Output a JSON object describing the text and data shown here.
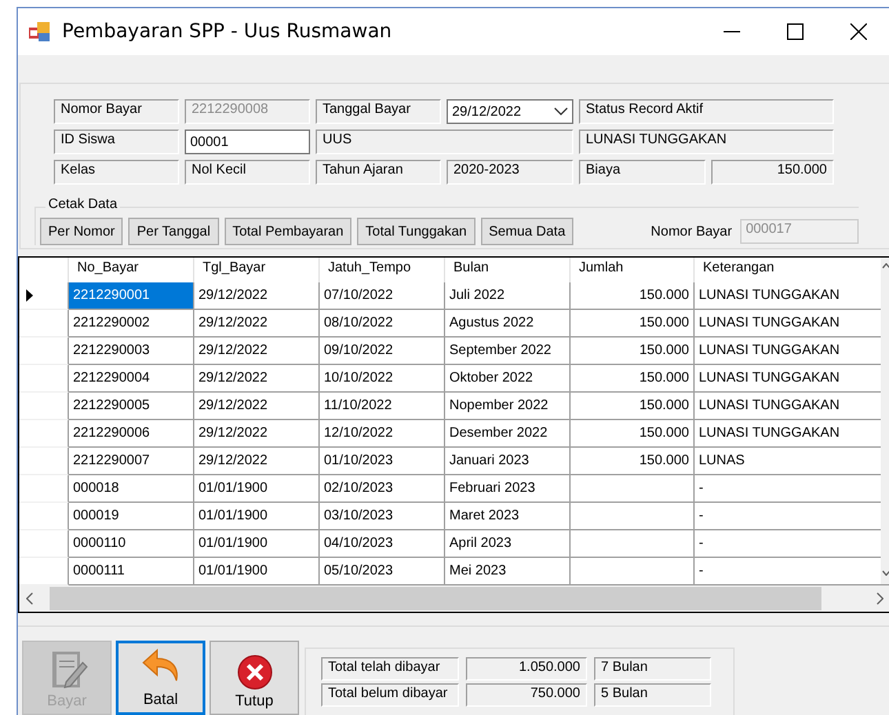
{
  "window": {
    "title": "Pembayaran SPP - Uus Rusmawan"
  },
  "form": {
    "nomor_bayar": {
      "label": "Nomor Bayar",
      "value": "2212290008",
      "disabled": true
    },
    "tanggal_bayar": {
      "label": "Tanggal Bayar",
      "value": "29/12/2022"
    },
    "status_record": "Status Record Aktif",
    "id_siswa": {
      "label": "ID Siswa",
      "value": "00001"
    },
    "nama": "UUS",
    "keterangan": "LUNASI TUNGGAKAN",
    "kelas": {
      "label": "Kelas",
      "value": "Nol Kecil"
    },
    "tahun_ajaran": {
      "label": "Tahun Ajaran",
      "value": "2020-2023"
    },
    "biaya": {
      "label": "Biaya",
      "value": "150.000"
    }
  },
  "cetak_data": {
    "title": "Cetak Data",
    "buttons": [
      "Per Nomor",
      "Per Tanggal",
      "Total Pembayaran",
      "Total Tunggakan",
      "Semua Data"
    ],
    "nomor_bayar": {
      "label": "Nomor Bayar",
      "value": "000017",
      "disabled": true
    }
  },
  "table": {
    "columns": [
      "No_Bayar",
      "Tgl_Bayar",
      "Jatuh_Tempo",
      "Bulan",
      "Jumlah",
      "Keterangan"
    ],
    "rows": [
      {
        "cells": [
          "2212290001",
          "29/12/2022",
          "07/10/2022",
          "Juli 2022",
          "150.000",
          "LUNASI TUNGGAKAN"
        ],
        "selected": true
      },
      {
        "cells": [
          "2212290002",
          "29/12/2022",
          "08/10/2022",
          "Agustus 2022",
          "150.000",
          "LUNASI TUNGGAKAN"
        ],
        "selected": false
      },
      {
        "cells": [
          "2212290003",
          "29/12/2022",
          "09/10/2022",
          "September 2022",
          "150.000",
          "LUNASI TUNGGAKAN"
        ],
        "selected": false
      },
      {
        "cells": [
          "2212290004",
          "29/12/2022",
          "10/10/2022",
          "Oktober 2022",
          "150.000",
          "LUNASI TUNGGAKAN"
        ],
        "selected": false
      },
      {
        "cells": [
          "2212290005",
          "29/12/2022",
          "11/10/2022",
          "Nopember 2022",
          "150.000",
          "LUNASI TUNGGAKAN"
        ],
        "selected": false
      },
      {
        "cells": [
          "2212290006",
          "29/12/2022",
          "12/10/2022",
          "Desember 2022",
          "150.000",
          "LUNASI TUNGGAKAN"
        ],
        "selected": false
      },
      {
        "cells": [
          "2212290007",
          "29/12/2022",
          "01/10/2023",
          "Januari 2023",
          "150.000",
          "LUNAS"
        ],
        "selected": false
      },
      {
        "cells": [
          "000018",
          "01/01/1900",
          "02/10/2023",
          "Februari 2023",
          "",
          "-"
        ],
        "selected": false
      },
      {
        "cells": [
          "000019",
          "01/01/1900",
          "03/10/2023",
          "Maret 2023",
          "",
          "-"
        ],
        "selected": false
      },
      {
        "cells": [
          "0000110",
          "01/01/1900",
          "04/10/2023",
          "April 2023",
          "",
          "-"
        ],
        "selected": false
      },
      {
        "cells": [
          "0000111",
          "01/01/1900",
          "05/10/2023",
          "Mei 2023",
          "",
          "-"
        ],
        "selected": false
      }
    ]
  },
  "actions": [
    {
      "label": "Bayar",
      "kind": "notebook",
      "disabled": true,
      "focused": false
    },
    {
      "label": "Batal",
      "kind": "undo",
      "disabled": false,
      "focused": true
    },
    {
      "label": "Tutup",
      "kind": "close",
      "disabled": false,
      "focused": false
    }
  ],
  "summary": [
    {
      "label": "Total telah dibayar",
      "amount": "1.050.000",
      "months": "7 Bulan"
    },
    {
      "label": "Total belum dibayar",
      "amount": "750.000",
      "months": "5 Bulan"
    }
  ]
}
